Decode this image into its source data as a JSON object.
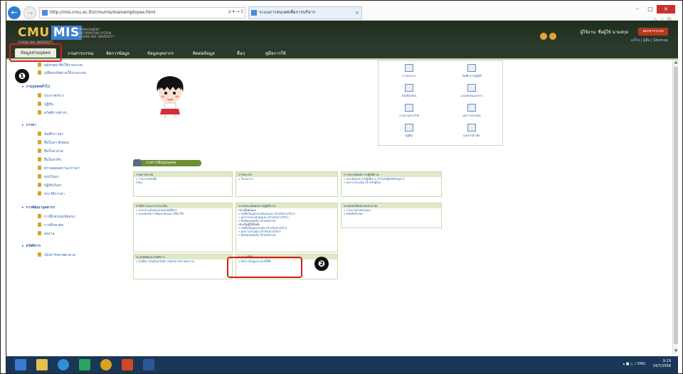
{
  "browser": {
    "address": "http://mis.cmu.ac.th/cmumis/mainemployee.html",
    "address_tools": "ρ ▾ → C",
    "tab_title": "ระบบสารสนเทศเพื่อการบริหาร",
    "tab_close": "×",
    "back": "←",
    "forward": "→",
    "min": "–",
    "max": "□",
    "close": "×",
    "right_icons": "⌂☆⚙"
  },
  "header": {
    "logo_main": "CMU",
    "logo_mis": "MIS",
    "logo_sub": "CHIANG MAI UNIVERSITY",
    "logo_desc": "MANAGEMENT INFORMATION SYSTEM CHIANG MAI UNIVERSITY",
    "user_name": "ผู้ใช้งาน: ชื่อผู้ใช้ นามสกุล",
    "logout_label": "ออกจากระบบ",
    "sub_links": "แก้ไข | คู่มือ | Sitemap"
  },
  "menu": [
    {
      "label": "ข้อมูลส่วนบุคคล"
    },
    {
      "label": "งานสารบรรณ"
    },
    {
      "label": "จัดการข้อมูล"
    },
    {
      "label": "ข้อมูลบุคลากร"
    },
    {
      "label": "ติดต่อข้อมูล"
    },
    {
      "label": "อื่นๆ"
    },
    {
      "label": "คู่มือการใช้"
    }
  ],
  "badges": {
    "one": "❶",
    "two": "❷"
  },
  "sidebar": {
    "items": [
      {
        "label": "สมัครสมาชิกใช้งานระบบ"
      },
      {
        "label": "เปลี่ยนรหัสผ่านใช้งานระบบ"
      },
      {
        "head": "งานบุคคลทั่วไป"
      },
      {
        "label": "ประกาศ/ข่าว"
      },
      {
        "label": "ปฏิทิน"
      },
      {
        "label": "สวัสดิการต่างๆ"
      },
      {
        "head": "การลา"
      },
      {
        "label": "บันทึกการลา"
      },
      {
        "label": "ยื่นใบลา พักผ่อน"
      },
      {
        "label": "ยื่นใบลาป่วย"
      },
      {
        "label": "ยื่นใบลากิจ"
      },
      {
        "label": "ตรวจสอบสถานะการลา"
      },
      {
        "label": "สรุปวันลา"
      },
      {
        "label": "ปฏิทินวันลา"
      },
      {
        "label": "ประวัติการลา"
      },
      {
        "head": "การพัฒนาบุคลากร"
      },
      {
        "label": "การฝึกอบรม/สัมมนา"
      },
      {
        "label": "การศึกษาต่อ"
      },
      {
        "label": "ผลงาน"
      },
      {
        "head": "สวัสดิการ"
      },
      {
        "label": "เบิกค่ารักษาพยาบาล"
      }
    ]
  },
  "icon_panel": [
    {
      "label": "การลงเวลา"
    },
    {
      "label": "บันทึกการปฏิบัติ"
    },
    {
      "label": "หนังสือเวียน"
    },
    {
      "label": "แบบฟอร์มเอกสาร"
    },
    {
      "label": "รายงานประจำปี"
    },
    {
      "label": "ผลการประเมิน"
    },
    {
      "label": "ปฏิทิน"
    },
    {
      "label": "เอกสารอ้างอิง"
    }
  ],
  "section_title": "รายการข้อมูลบุคคล",
  "boxes": [
    {
      "title": "งานสารบรรณ",
      "lines": [
        "» รายการหนังสือ",
        "  เวียน"
      ]
    },
    {
      "title": "การลงเวลา",
      "lines": [
        "» ใบลงเวลา"
      ]
    },
    {
      "title": "การประเมินผลการปฏิบัติงาน",
      "lines": [
        "» ประเมินผลการปฏิบัติงาน (สำหรับผู้บังคับบัญชา)",
        "» ผลการประเมิน (สำหรับผู้รับ)"
      ]
    },
    {
      "title": "สวัสดิการและการประเมิน",
      "lines": [
        "» แบบประเมินตนเองของนักศึกษา",
        "» แบบฟอร์มการพัฒนาตนเอง CMU PA"
      ]
    },
    {
      "title": "ระบบประเมินผลการปฏิบัติงาน",
      "lines": [
        "ประเมินตนเอง",
        "» บันทึกข้อมูลประเมินตนเอง (สำหรับสายวิชา)",
        "» ผลการประเมินตนเอง (สำหรับสายวิชา)",
        "» พิมพ์แบบฟอร์ม (สำหรับสาย)",
        "ประเมินผู้ใต้บังคับ",
        "» บันทึกข้อมูลประเมิน (สำหรับสายวิชา)",
        "» ผลการประเมิน (สำหรับสายวิชา)",
        "» พิมพ์แบบฟอร์ม (สำหรับสาย)"
      ]
    },
    {
      "title": "ระบบเงินได้นอกงบประมาณ",
      "lines": [
        "» รายงานค่าตอบแทน",
        "» หนังสือรับรอง"
      ]
    },
    {
      "title": "ระบบสิทธิและสวัสดิการ",
      "lines": [
        "» บันทึกการขอรับสวัสดิการเบิกค่ารักษาพยาบาล"
      ]
    },
    {
      "title": "ระบบ HRM",
      "lines": [
        "» จัดการข้อมูลระบบ HRM"
      ]
    }
  ],
  "taskbar": {
    "tray": "▴ ■ △ ♪ ENG",
    "time": "9:19",
    "date": "14/7/2558"
  },
  "colors": {
    "accent_red": "#d41c1c",
    "menu_bg": "#2a3a2a",
    "link": "#2a5caa"
  }
}
